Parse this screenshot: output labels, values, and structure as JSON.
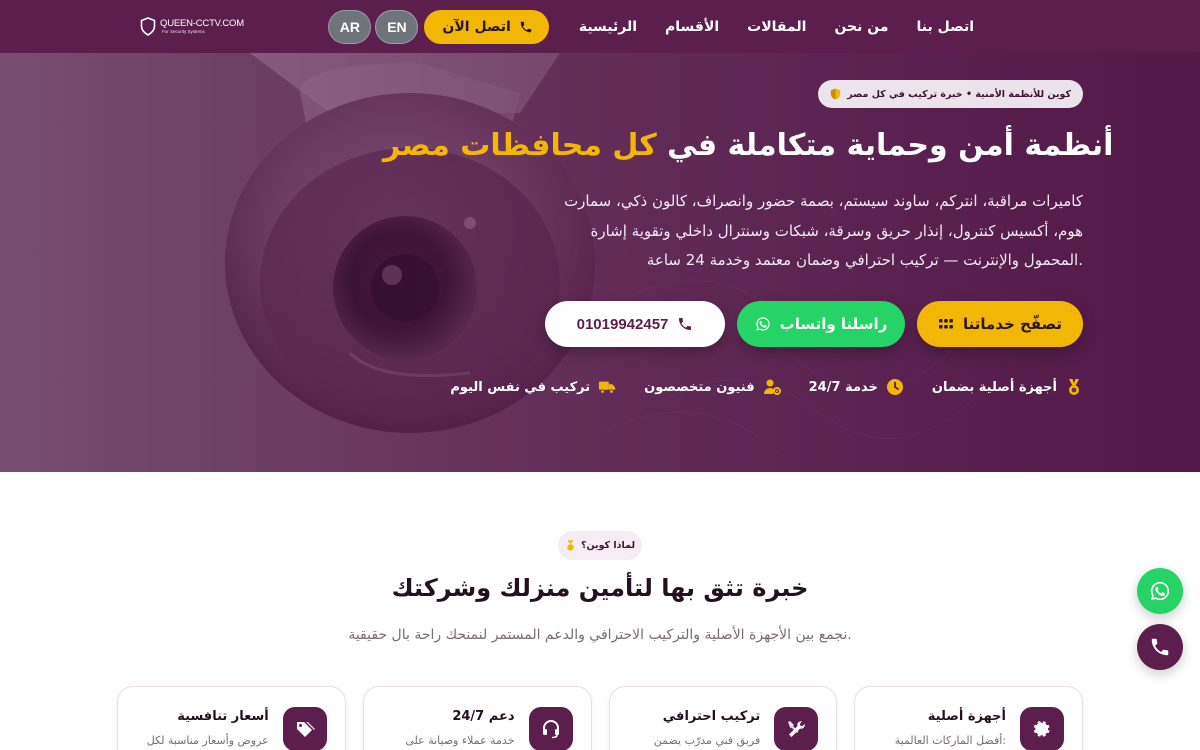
{
  "header": {
    "logo_name": "QUEEN-CCTV.COM",
    "logo_tagline": "For Security Systems",
    "lang_ar": "AR",
    "lang_en": "EN",
    "call_now": "اتصل الآن",
    "nav": [
      "الرئيسية",
      "الأقسام",
      "المقالات",
      "من نحن",
      "اتصل بنا"
    ]
  },
  "hero": {
    "badge": "كوين للأنظمة الأمنية • خبرة تركيب في كل مصر",
    "title_main": "أنظمة أمن وحماية متكاملة في",
    "title_accent": "كل محافظات مصر",
    "description": "كاميرات مراقبة، انتركم، ساوند سيستم، بصمة حضور وانصراف، كالون ذكي، سمارت هوم، أكسيس كنترول، إنذار حريق وسرقة، شبكات وسنترال داخلي وتقوية إشارة المحمول والإنترنت — تركيب احترافي وضمان معتمد وخدمة 24 ساعة.",
    "btn_services": "تصفّح خدماتنا",
    "btn_whatsapp": "راسلنا واتساب",
    "btn_phone": "01019942457",
    "features": [
      {
        "icon": "medal-icon",
        "label": "أجهزة أصلية بضمان"
      },
      {
        "icon": "clock-icon",
        "label": "خدمة 24/7"
      },
      {
        "icon": "user-gear-icon",
        "label": "فنيون متخصصون"
      },
      {
        "icon": "truck-icon",
        "label": "تركيب في نفس اليوم"
      }
    ]
  },
  "why": {
    "badge": "لماذا كوين؟",
    "title": "خبرة تثق بها لتأمين منزلك وشركتك",
    "subtitle": "نجمع بين الأجهزة الأصلية والتركيب الاحترافي والدعم المستمر لنمنحك راحة بال حقيقية.",
    "cards": [
      {
        "icon": "gear-icon",
        "title": "أجهزة أصلية",
        "text": "أفضل الماركات العالمية:"
      },
      {
        "icon": "tools-icon",
        "title": "تركيب احترافي",
        "text": "فريق فني مدرّب يضمن"
      },
      {
        "icon": "headset-icon",
        "title": "دعم 24/7",
        "text": "خدمة عملاء وصيانة على"
      },
      {
        "icon": "tags-icon",
        "title": "أسعار تنافسية",
        "text": "عروض وأسعار مناسبة لكل"
      }
    ]
  },
  "colors": {
    "brand": "#5c1e4c",
    "accent": "#f2b705",
    "whatsapp": "#25d366"
  }
}
